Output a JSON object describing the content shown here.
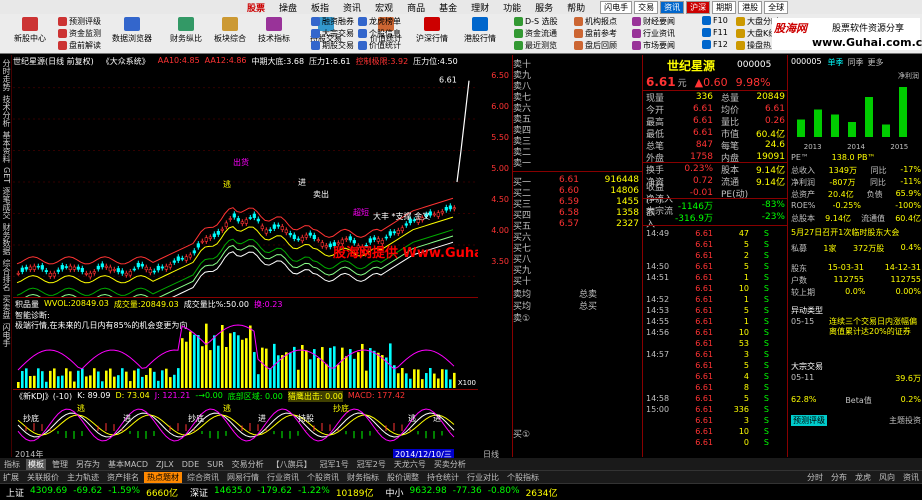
{
  "menu": {
    "items": [
      "股票",
      "操盘",
      "板指",
      "资讯",
      "宏观",
      "商品",
      "基金",
      "理财",
      "功能",
      "服务",
      "帮助"
    ],
    "active": "股票",
    "tags": [
      {
        "label": "闪电手",
        "style": "plain"
      },
      {
        "label": "交易",
        "style": "plain"
      },
      {
        "label": "资讯",
        "style": "blue"
      },
      {
        "label": "沪深",
        "style": "red"
      },
      {
        "label": "期期",
        "style": "plain"
      },
      {
        "label": "港股",
        "style": "plain"
      },
      {
        "label": "全球",
        "style": "plain"
      }
    ]
  },
  "toolbar": {
    "big_buttons": [
      "新股中心",
      "数据浏览器",
      "财务纵比",
      "板块综合",
      "技术指标",
      "持股交易",
      "价值统计",
      "沪深行情",
      "港股行情"
    ],
    "small_buttons": [
      "预测评级",
      "资金监测",
      "盘前解读",
      "融资融券",
      "大宗交易",
      "期股交易",
      "龙虎榜单",
      "个股信息",
      "价值统计",
      "D-S 选股",
      "资金流通",
      "最近测览",
      "机构报点",
      "盘前参考",
      "盘后回顾",
      "财经要闻",
      "行业资讯",
      "市场要闻",
      "F10",
      "F11",
      "F12",
      "大盘分时",
      "大盘K线",
      "操盘热点"
    ]
  },
  "logo": {
    "line1": "股海网",
    "line2": "股票软件资源分享",
    "line3": "www.Guhai.com.cn"
  },
  "leftbar": {
    "tabs": [
      "分时走势",
      "技术分析",
      "基本资料",
      "GET",
      "逐笔成交",
      "财务数据",
      "综合排名",
      "买卖盘",
      "闪电手"
    ]
  },
  "chart": {
    "title": "世纪星源(日线 前复权)",
    "system": "《大众系统》",
    "readouts": [
      {
        "label": "AA10:",
        "value": "4.85",
        "color": "#f33"
      },
      {
        "label": "AA12:",
        "value": "4.86",
        "color": "#f33"
      },
      {
        "label": "中期大底:",
        "value": "3.68",
        "color": "#fff"
      },
      {
        "label": "压力1:",
        "value": "6.61",
        "color": "#fff"
      },
      {
        "label": "控制极限:",
        "value": "3.92",
        "color": "#f33"
      },
      {
        "label": "压力位:",
        "value": "4.50",
        "color": "#fff"
      }
    ],
    "watermark": "股海网提供 Www.Guhai.Com.CN",
    "annotations": [
      "出货",
      "逃",
      "进",
      "卖出",
      "超短",
      "大丰 *支撑 金叉"
    ],
    "high_label": "6.61"
  },
  "yaxis": {
    "ticks": [
      "6.50",
      "6.00",
      "5.50",
      "5.00",
      "4.50",
      "4.00",
      "3.50"
    ]
  },
  "volume": {
    "header": "积品量",
    "wvol_label": "WVOL:",
    "wvol": "20849.03",
    "vol_label": "成交量:",
    "vol": "20849.03",
    "ratio_label": "成交量比%:",
    "ratio": "50.00",
    "huan": "换:",
    "huan_v": "0.23",
    "diag1": "智能诊断:",
    "diag2": "极端行情,在未来的几日内有85%的机会变更为向",
    "scale": "X100"
  },
  "kdj": {
    "header": "《新KDJ》(-10)",
    "k": "K: 89.09",
    "d": "D: 73.04",
    "j": "J: 121.21",
    "lvl": "-→0.00",
    "bottom": "底部区域: 0.00",
    "sig": "猎鹰出击: 0.00",
    "macd": "MACD: 177.42",
    "marks": [
      "抄底",
      "逃",
      "进",
      "抄底",
      "逃",
      "进",
      "持股",
      "抄底",
      "逃",
      "进"
    ]
  },
  "dates": {
    "left": "2014年",
    "right": "2014/12/10/三",
    "daylbl": "日线"
  },
  "orderbook": {
    "sells": [
      {
        "label": "卖十"
      },
      {
        "label": "卖九"
      },
      {
        "label": "卖八"
      },
      {
        "label": "卖七"
      },
      {
        "label": "卖六"
      },
      {
        "label": "卖五"
      },
      {
        "label": "卖四"
      },
      {
        "label": "卖三"
      },
      {
        "label": "卖二"
      },
      {
        "label": "卖一"
      }
    ],
    "buys": [
      {
        "label": "买一",
        "price": "6.61",
        "vol": "916448"
      },
      {
        "label": "买二",
        "price": "6.60",
        "vol": "14806"
      },
      {
        "label": "买三",
        "price": "6.59",
        "vol": "1455"
      },
      {
        "label": "买四",
        "price": "6.58",
        "vol": "1358"
      },
      {
        "label": "买五",
        "price": "6.57",
        "vol": "2327"
      },
      {
        "label": "买六",
        "price": "",
        "vol": ""
      },
      {
        "label": "买七",
        "price": "",
        "vol": ""
      },
      {
        "label": "买八",
        "price": "",
        "vol": ""
      },
      {
        "label": "买九",
        "price": "",
        "vol": ""
      },
      {
        "label": "买十",
        "price": "",
        "vol": ""
      }
    ],
    "avg_sell": "卖均",
    "avg_buy": "买均",
    "total_sell": "总卖",
    "total_buy": "总买",
    "sell_marker": "卖①",
    "buy_marker": "买①"
  },
  "quote": {
    "name": "世纪星源",
    "code": "000005",
    "price": "6.61",
    "price_unit": "元",
    "change": "▲0.60",
    "pct": "9.98%",
    "rows": [
      {
        "k": "现量",
        "v": "336",
        "k2": "总量",
        "v2": "20849"
      },
      {
        "k": "今开",
        "v": "6.61",
        "k2": "均价",
        "v2": "6.61"
      },
      {
        "k": "最高",
        "v": "6.61",
        "k2": "量比",
        "v2": "0.26"
      },
      {
        "k": "最低",
        "v": "6.61",
        "k2": "市值",
        "v2": "60.4亿"
      },
      {
        "k": "总笔",
        "v": "847",
        "k2": "每笔",
        "v2": "24.6"
      },
      {
        "k": "外盘",
        "v": "1758",
        "k2": "内盘",
        "v2": "19091"
      },
      {
        "k": "换手",
        "v": "0.23%",
        "k2": "股本",
        "v2": "9.14亿"
      },
      {
        "k": "净资",
        "v": "0.72",
        "k2": "流通",
        "v2": "9.14亿"
      },
      {
        "k": "收益(一)",
        "v": "-0.01",
        "k2": "PE(动)",
        "v2": ""
      },
      {
        "k": "净流入额",
        "v": "-1146万",
        "k2": "",
        "v2": "-83%"
      },
      {
        "k": "大宗流入",
        "v": "-316.9万",
        "k2": "",
        "v2": "-23%"
      }
    ],
    "ticks": [
      {
        "t": "14:49",
        "p": "6.61",
        "v": "47",
        "s": "S"
      },
      {
        "t": "",
        "p": "6.61",
        "v": "5",
        "s": "S"
      },
      {
        "t": "",
        "p": "6.61",
        "v": "2",
        "s": "S"
      },
      {
        "t": "14:50",
        "p": "6.61",
        "v": "5",
        "s": "S"
      },
      {
        "t": "14:51",
        "p": "6.61",
        "v": "1",
        "s": "S"
      },
      {
        "t": "",
        "p": "6.61",
        "v": "10",
        "s": "S"
      },
      {
        "t": "14:52",
        "p": "6.61",
        "v": "1",
        "s": "S"
      },
      {
        "t": "14:53",
        "p": "6.61",
        "v": "5",
        "s": "S"
      },
      {
        "t": "14:55",
        "p": "6.61",
        "v": "1",
        "s": "S"
      },
      {
        "t": "14:56",
        "p": "6.61",
        "v": "10",
        "s": "S"
      },
      {
        "t": "",
        "p": "6.61",
        "v": "53",
        "s": "S"
      },
      {
        "t": "14:57",
        "p": "6.61",
        "v": "3",
        "s": "S"
      },
      {
        "t": "",
        "p": "6.61",
        "v": "5",
        "s": "S"
      },
      {
        "t": "",
        "p": "6.61",
        "v": "4",
        "s": "S"
      },
      {
        "t": "",
        "p": "6.61",
        "v": "8",
        "s": "S"
      },
      {
        "t": "14:58",
        "p": "6.61",
        "v": "5",
        "s": "S"
      },
      {
        "t": "15:00",
        "p": "6.61",
        "v": "336",
        "s": "S"
      },
      {
        "t": "",
        "p": "6.61",
        "v": "3",
        "s": "S"
      },
      {
        "t": "",
        "p": "6.61",
        "v": "10",
        "s": "S"
      },
      {
        "t": "",
        "p": "6.61",
        "v": "0",
        "s": "S"
      }
    ]
  },
  "info": {
    "code": "000005",
    "tabs": [
      "单季",
      "同季",
      "更多"
    ],
    "profit_label": "净利润",
    "years": [
      "2013",
      "2014",
      "2015"
    ],
    "bars": [
      0.35,
      0.55,
      0.45,
      0.3,
      0.8,
      0.25,
      1.0
    ],
    "rows": [
      {
        "k": "PE™",
        "v": "138.0 PB™"
      },
      {
        "k": "总收入",
        "v": "1349万"
      },
      {
        "k": "净利润",
        "v": "-807万"
      },
      {
        "k": "总资产",
        "v": "20.4亿"
      },
      {
        "k": "ROE%",
        "v": "-0.25%"
      },
      {
        "k": "总股本",
        "v": "9.14亿"
      }
    ],
    "row_tails": [
      "",
      "同比",
      "同比",
      "负债",
      "",
      "流通值"
    ],
    "tail_vals": [
      "",
      "-17%",
      "-11%",
      "65.9%",
      "-100%",
      "60.4亿"
    ],
    "announce": "5月27日召开1次临时股东大会",
    "holder_k": "私募",
    "holder_v": "1家",
    "holder_v2": "372万股",
    "holder_pct": "0.4%",
    "rows2": [
      {
        "k": "股东",
        "v": "15-03-31",
        "v2": "14-12-31"
      },
      {
        "k": "户数",
        "v": "112755",
        "v2": "112755"
      },
      {
        "k": "较上期",
        "v": "0.0%",
        "v2": "0.00%"
      }
    ],
    "anomaly_title": "异动类型",
    "anomaly_date": "05-15",
    "anomaly_text": "连续三个交易日内涨幅偏离值累计达20%的证券",
    "bulk_title": "大宗交易",
    "bulk_date": "05-11",
    "bulk_v": "39.6万",
    "bulk_pct": "62.8%",
    "beta_label": "Beta值",
    "beta": "0.2%",
    "rating": "预测评级",
    "rating2": "主题投资"
  },
  "bottombar": {
    "tabs": [
      "指标",
      "模板",
      "管理",
      "另存为",
      "基本MACD",
      "ZJLX",
      "DDE",
      "SUR",
      "交易分析",
      "【八旗兵】",
      "冠军1号",
      "冠军2号",
      "天龙六号",
      "买卖分析"
    ],
    "active": "模板"
  },
  "bottom2": {
    "tabs": [
      "扩展",
      "关联报价",
      "主力轨迹",
      "资产排名",
      "热点题材",
      "综合资讯",
      "网易行情",
      "行业资讯",
      "个股资讯",
      "财务指标",
      "股价调整",
      "持仓统计",
      "行业对比",
      "个股指标"
    ],
    "hl": "热点题材",
    "right": [
      "分时",
      "分布",
      "龙虎",
      "风向",
      "资讯"
    ]
  },
  "indices": [
    {
      "name": "上证",
      "v": "4309.69",
      "c": "-69.62",
      "p": "-1.59%",
      "amt": "6660亿"
    },
    {
      "name": "深证",
      "v": "14635.0",
      "c": "-179.62",
      "p": "-1.22%",
      "amt": "10189亿"
    },
    {
      "name": "中小",
      "v": "9632.98",
      "c": "-77.36",
      "p": "-0.80%",
      "amt": "2634亿"
    }
  ],
  "colors": {
    "up": "#ff3333",
    "down": "#00ff00",
    "yellow": "#ffff00",
    "frame": "#800000"
  }
}
